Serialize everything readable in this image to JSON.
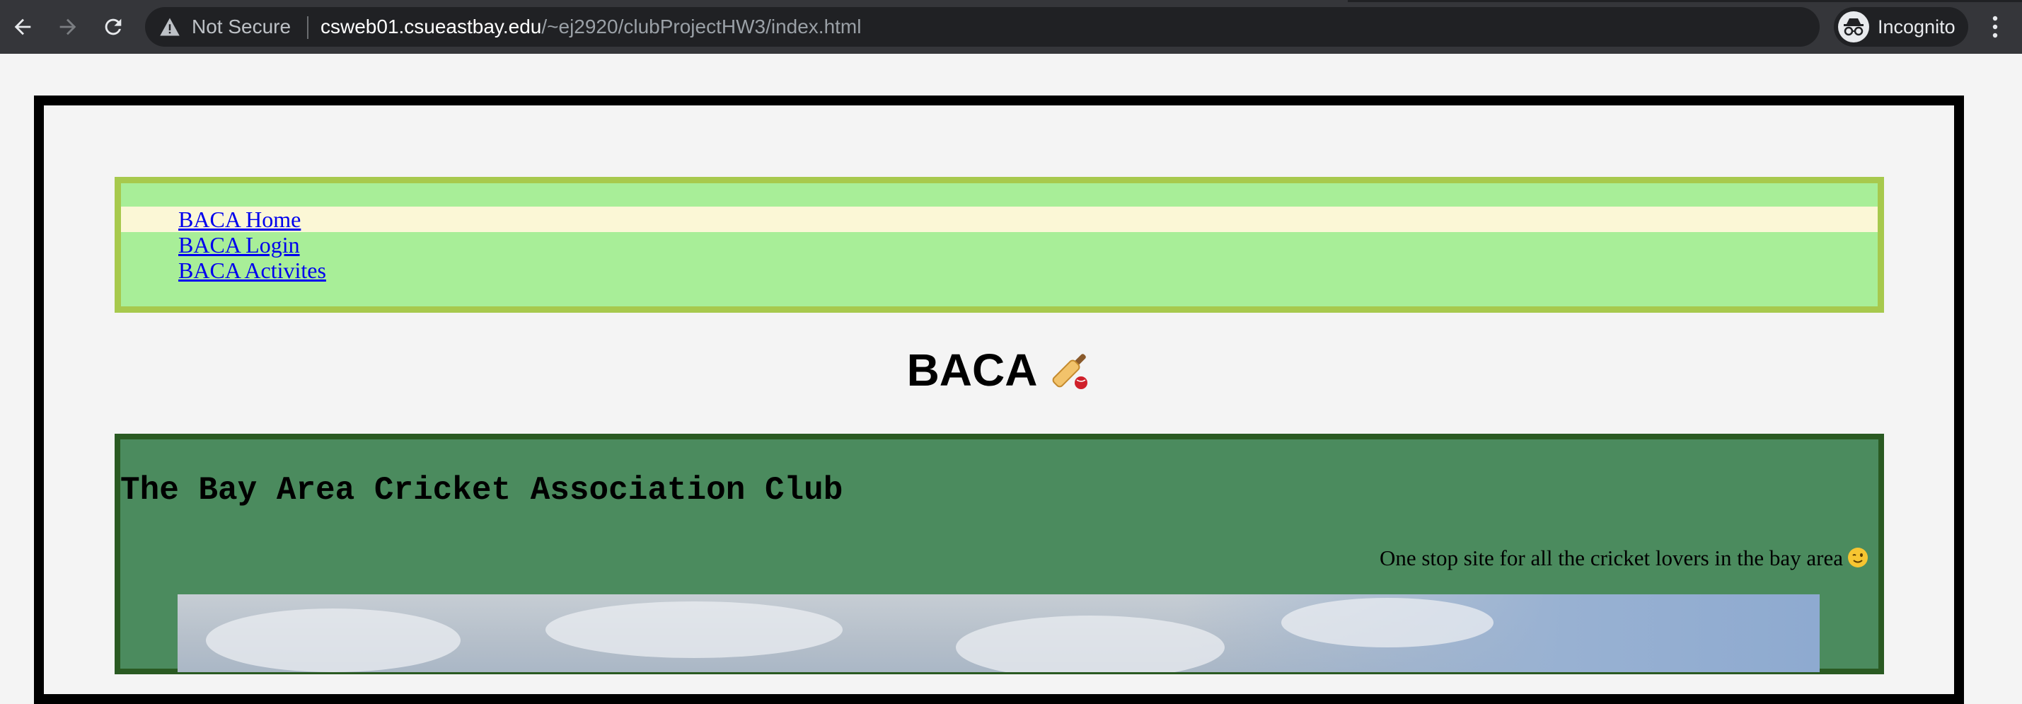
{
  "browser": {
    "security_label": "Not Secure",
    "url_host": "csweb01.csueastbay.edu",
    "url_path": "/~ej2920/clubProjectHW3/index.html",
    "profile_label": "Incognito"
  },
  "nav": {
    "items": [
      {
        "label": "BACA Home",
        "active": true
      },
      {
        "label": "BACA Login",
        "active": false
      },
      {
        "label": "BACA Activites",
        "active": false
      }
    ]
  },
  "header": {
    "brand": "BACA",
    "brand_icon": "cricket-bat-icon"
  },
  "hero": {
    "title": "The Bay Area Cricket Association Club",
    "tagline": "One stop site for all the cricket lovers in the bay area",
    "tagline_icon": "winking-face-icon",
    "image_name": "cricket-ground-photo"
  },
  "colors": {
    "page_bg": "#f4f4f4",
    "nav_bg": "#a8ee98",
    "nav_border": "#a7c94d",
    "nav_active_bg": "#fbf7d6",
    "hero_bg": "#4b8b5e",
    "hero_border": "#2a5a22",
    "link": "#0000ee"
  }
}
